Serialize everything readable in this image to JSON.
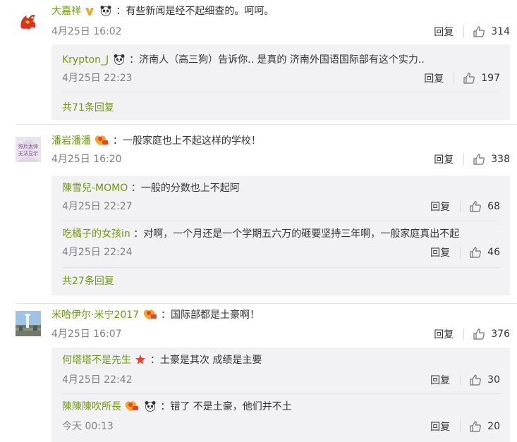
{
  "comments": [
    {
      "user": "大嘉祥",
      "badges": [
        "vip-v-icon",
        "panda-icon"
      ],
      "text": "：有些新闻是经不起细查的。呵呵。",
      "time": "4月25日 16:02",
      "reply_label": "回复",
      "likes": "314",
      "replies": [
        {
          "user": "Krypton_J",
          "badges": [
            "panda-icon"
          ],
          "text": "：济南人（高三狗）告诉你.. 是真的 济南外国语国际部有这个实力..",
          "time": "4月25日 22:23",
          "reply_label": "回复",
          "likes": "197"
        }
      ],
      "more_label": "共71条回复"
    },
    {
      "user": "潘岩潘潘",
      "badges": [
        "fan-badge-icon"
      ],
      "text": "：一般家庭也上不起这样的学校！",
      "avatar_text": [
        "照片太帅",
        "无法显示"
      ],
      "time": "4月25日 16:20",
      "reply_label": "回复",
      "likes": "338",
      "replies": [
        {
          "user": "陳雪兒-MOMO",
          "badges": [],
          "text": "：一般的分数也上不起阿",
          "time": "4月25日 22:27",
          "reply_label": "回复",
          "likes": "68"
        },
        {
          "user": "吃橘子的女孩in",
          "badges": [],
          "text": "：对啊，一个月还是一个学期五六万的砸要坚持三年啊，一般家庭真出不起",
          "time": "4月25日 22:24",
          "reply_label": "回复",
          "likes": "46"
        }
      ],
      "more_label": "共27条回复"
    },
    {
      "user": "米哈伊尔·米宁2017",
      "badges": [
        "fan-badge-icon"
      ],
      "text": "：国际部都是土豪啊！",
      "time": "4月25日 16:07",
      "reply_label": "回复",
      "likes": "376",
      "replies": [
        {
          "user": "何塔塔不是先生",
          "badges": [
            "red-star-icon"
          ],
          "text": "：土豪是其次  成绩是主要",
          "time": "4月25日 22:42",
          "reply_label": "回复",
          "likes": "30"
        },
        {
          "user": "陳陳陳吹所長",
          "badges": [
            "fan-badge-icon",
            "panda-icon"
          ],
          "text": "：错了 不是土豪，他们并不土",
          "time": "今天 00:13",
          "reply_label": "回复",
          "likes": "20"
        }
      ]
    }
  ],
  "colors": {
    "username": "#6e9a0e",
    "reply_bg": "#f2f2f5",
    "meta": "#808080",
    "v_badge": "#f6a623"
  }
}
